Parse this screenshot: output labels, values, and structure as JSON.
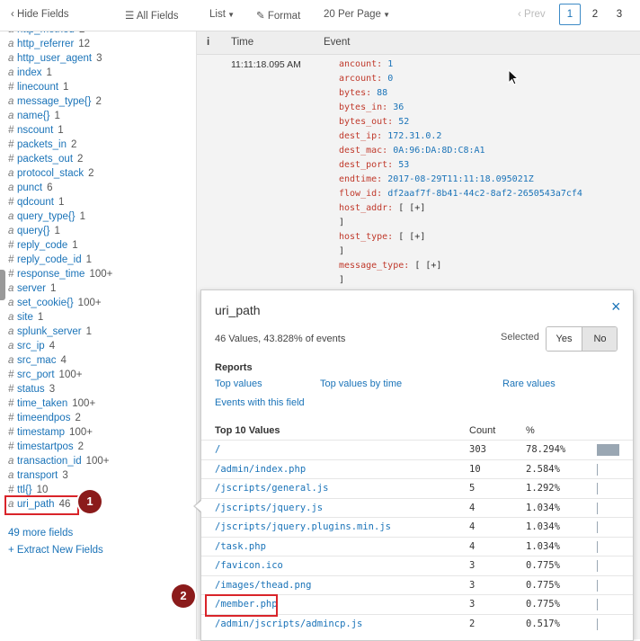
{
  "topbar": {
    "hide_fields": "Hide Fields",
    "all_fields": "All Fields",
    "list": "List",
    "format": "Format",
    "per_page": "20 Per Page",
    "prev": "Prev",
    "pages": [
      "1",
      "2",
      "3"
    ],
    "active_page": "1"
  },
  "fields": [
    {
      "type": "a",
      "name": "http_method",
      "count": "2"
    },
    {
      "type": "a",
      "name": "http_referrer",
      "count": "12"
    },
    {
      "type": "a",
      "name": "http_user_agent",
      "count": "3"
    },
    {
      "type": "a",
      "name": "index",
      "count": "1"
    },
    {
      "type": "#",
      "name": "linecount",
      "count": "1"
    },
    {
      "type": "a",
      "name": "message_type{}",
      "count": "2"
    },
    {
      "type": "a",
      "name": "name{}",
      "count": "1"
    },
    {
      "type": "#",
      "name": "nscount",
      "count": "1"
    },
    {
      "type": "#",
      "name": "packets_in",
      "count": "2"
    },
    {
      "type": "#",
      "name": "packets_out",
      "count": "2"
    },
    {
      "type": "a",
      "name": "protocol_stack",
      "count": "2"
    },
    {
      "type": "a",
      "name": "punct",
      "count": "6"
    },
    {
      "type": "#",
      "name": "qdcount",
      "count": "1"
    },
    {
      "type": "a",
      "name": "query_type{}",
      "count": "1"
    },
    {
      "type": "a",
      "name": "query{}",
      "count": "1"
    },
    {
      "type": "#",
      "name": "reply_code",
      "count": "1"
    },
    {
      "type": "#",
      "name": "reply_code_id",
      "count": "1"
    },
    {
      "type": "#",
      "name": "response_time",
      "count": "100+"
    },
    {
      "type": "a",
      "name": "server",
      "count": "1"
    },
    {
      "type": "a",
      "name": "set_cookie{}",
      "count": "100+"
    },
    {
      "type": "a",
      "name": "site",
      "count": "1"
    },
    {
      "type": "a",
      "name": "splunk_server",
      "count": "1"
    },
    {
      "type": "a",
      "name": "src_ip",
      "count": "4"
    },
    {
      "type": "a",
      "name": "src_mac",
      "count": "4"
    },
    {
      "type": "#",
      "name": "src_port",
      "count": "100+"
    },
    {
      "type": "#",
      "name": "status",
      "count": "3"
    },
    {
      "type": "#",
      "name": "time_taken",
      "count": "100+"
    },
    {
      "type": "#",
      "name": "timeendpos",
      "count": "2"
    },
    {
      "type": "#",
      "name": "timestamp",
      "count": "100+"
    },
    {
      "type": "#",
      "name": "timestartpos",
      "count": "2"
    },
    {
      "type": "a",
      "name": "transaction_id",
      "count": "100+"
    },
    {
      "type": "a",
      "name": "transport",
      "count": "3"
    },
    {
      "type": "#",
      "name": "ttl{}",
      "count": "10"
    },
    {
      "type": "a",
      "name": "uri_path",
      "count": "46"
    }
  ],
  "more_fields": "49 more fields",
  "extract_fields": "+ Extract New Fields",
  "events": {
    "col_info": "i",
    "col_time": "Time",
    "col_event": "Event",
    "time": "11:11:18.095 AM",
    "lines": [
      {
        "k": "ancount:",
        "v": "1"
      },
      {
        "k": "arcount:",
        "v": "0"
      },
      {
        "k": "bytes:",
        "v": "88"
      },
      {
        "k": "bytes_in:",
        "v": "36"
      },
      {
        "k": "bytes_out:",
        "v": "52"
      },
      {
        "k": "dest_ip:",
        "v": "172.31.0.2"
      },
      {
        "k": "dest_mac:",
        "v": "0A:96:DA:8D:C8:A1"
      },
      {
        "k": "dest_port:",
        "v": "53"
      },
      {
        "k": "endtime:",
        "v": "2017-08-29T11:11:18.095021Z"
      },
      {
        "k": "flow_id:",
        "v": "df2aaf7f-8b41-44c2-8af2-2650543a7cf4"
      },
      {
        "k": "host_addr:",
        "v": "[ [+]"
      },
      {
        "k": "",
        "v": "]"
      },
      {
        "k": "host_type:",
        "v": "[ [+]"
      },
      {
        "k": "",
        "v": "]"
      },
      {
        "k": "message_type:",
        "v": "[ [+]"
      },
      {
        "k": "",
        "v": "]"
      }
    ]
  },
  "popup": {
    "title": "uri_path",
    "close": "×",
    "summary": "46 Values, 43.828% of events",
    "selected_label": "Selected",
    "yes": "Yes",
    "no": "No",
    "reports_title": "Reports",
    "top_values": "Top values",
    "top_values_by_time": "Top values by time",
    "rare_values": "Rare values",
    "events_with_field": "Events with this field",
    "top10_title": "Top 10 Values",
    "count_header": "Count",
    "pct_header": "%",
    "values": [
      {
        "value": "/",
        "count": "303",
        "pct": "78.294%",
        "fraction": 0.78294
      },
      {
        "value": "/admin/index.php",
        "count": "10",
        "pct": "2.584%",
        "fraction": 0.02584
      },
      {
        "value": "/jscripts/general.js",
        "count": "5",
        "pct": "1.292%",
        "fraction": 0.01292
      },
      {
        "value": "/jscripts/jquery.js",
        "count": "4",
        "pct": "1.034%",
        "fraction": 0.01034
      },
      {
        "value": "/jscripts/jquery.plugins.min.js",
        "count": "4",
        "pct": "1.034%",
        "fraction": 0.01034
      },
      {
        "value": "/task.php",
        "count": "4",
        "pct": "1.034%",
        "fraction": 0.01034
      },
      {
        "value": "/favicon.ico",
        "count": "3",
        "pct": "0.775%",
        "fraction": 0.00775
      },
      {
        "value": "/images/thead.png",
        "count": "3",
        "pct": "0.775%",
        "fraction": 0.00775
      },
      {
        "value": "/member.php",
        "count": "3",
        "pct": "0.775%",
        "fraction": 0.00775
      },
      {
        "value": "/admin/jscripts/admincp.js",
        "count": "2",
        "pct": "0.517%",
        "fraction": 0.00517
      }
    ]
  },
  "callouts": [
    "1",
    "2"
  ]
}
